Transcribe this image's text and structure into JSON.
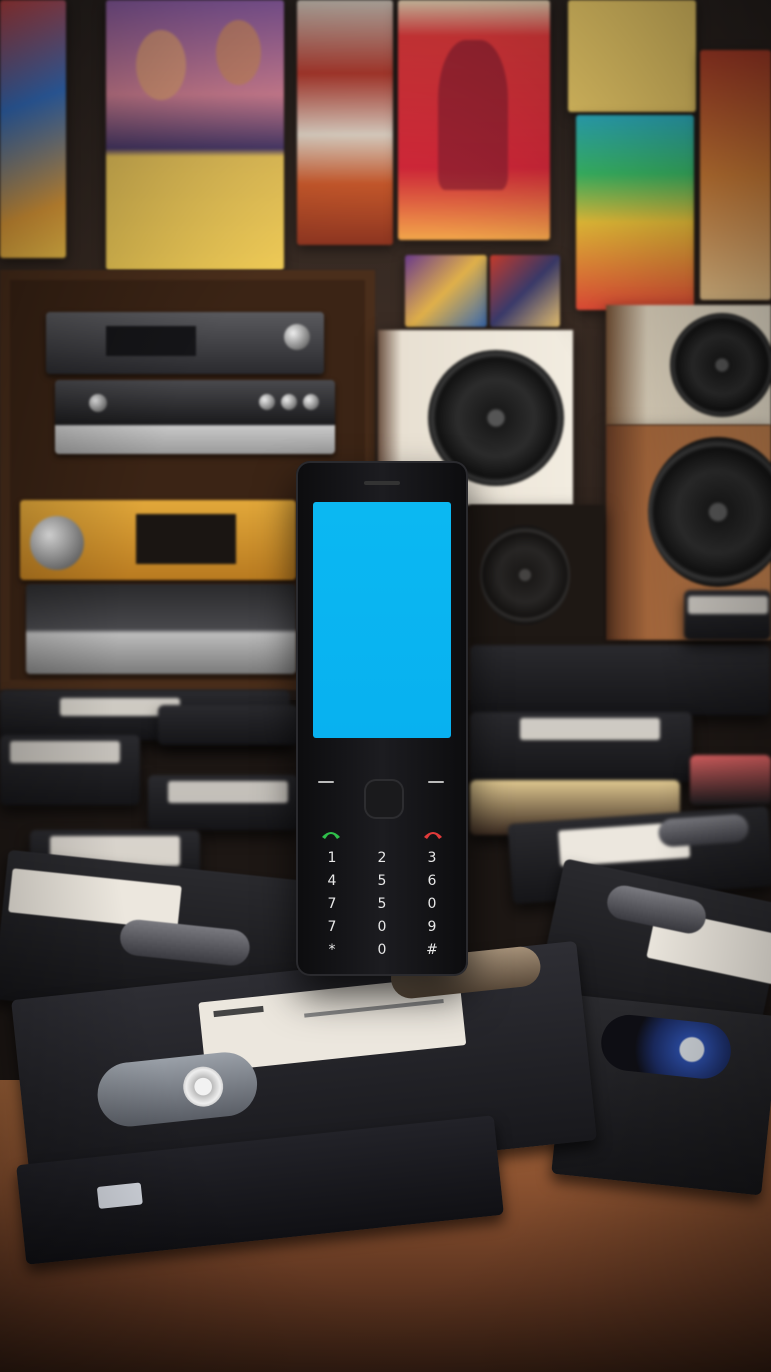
{
  "scene": {
    "description_colors": {
      "phone_screen": "#0ab5f1",
      "phone_body": "#151518",
      "table": "#8b5230",
      "wall": "#2a2320"
    }
  },
  "phone": {
    "keys": [
      [
        "1",
        "2",
        "3"
      ],
      [
        "4",
        "5",
        "6"
      ],
      [
        "7",
        "5",
        "0"
      ],
      [
        "7",
        "0",
        "9"
      ],
      [
        "*",
        "0",
        "#"
      ]
    ],
    "call_icon": "call-green-icon",
    "end_icon": "end-call-red-icon"
  }
}
